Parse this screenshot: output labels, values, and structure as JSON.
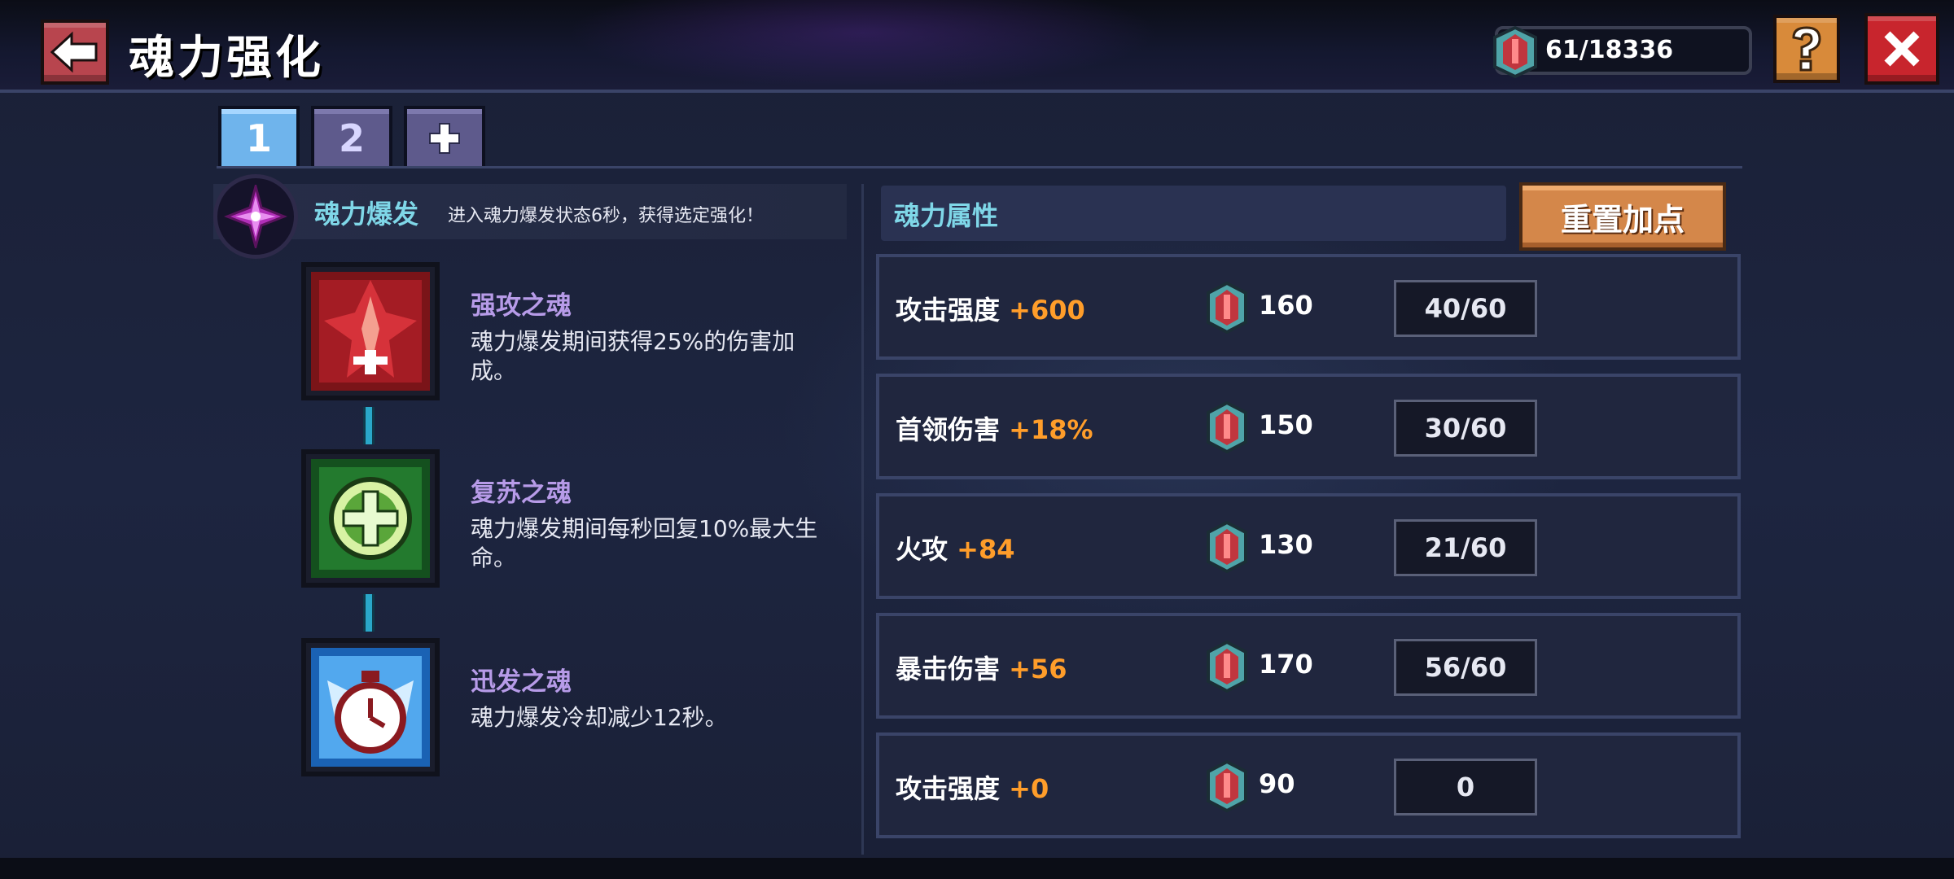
{
  "header": {
    "title": "魂力强化",
    "currency": "61/18336"
  },
  "tabs": [
    {
      "label": "1",
      "active": true
    },
    {
      "label": "2",
      "active": false
    },
    {
      "label": "+",
      "active": false
    }
  ],
  "burst": {
    "title": "魂力爆发",
    "description": "进入魂力爆发状态6秒，获得选定强化！"
  },
  "skills": [
    {
      "name": "强攻之魂",
      "description": "魂力爆发期间获得25%的伤害加成。"
    },
    {
      "name": "复苏之魂",
      "description": "魂力爆发期间每秒回复10%最大生命。"
    },
    {
      "name": "迅发之魂",
      "description": "魂力爆发冷却减少12秒。"
    }
  ],
  "attributes": {
    "title": "魂力属性",
    "reset_label": "重置加点",
    "rows": [
      {
        "label": "攻击强度",
        "bonus": "+600",
        "cost": "160",
        "level": "40/60"
      },
      {
        "label": "首领伤害",
        "bonus": "+18%",
        "cost": "150",
        "level": "30/60"
      },
      {
        "label": "火攻",
        "bonus": "+84",
        "cost": "130",
        "level": "21/60"
      },
      {
        "label": "暴击伤害",
        "bonus": "+56",
        "cost": "170",
        "level": "56/60"
      },
      {
        "label": "攻击强度",
        "bonus": "+0",
        "cost": "90",
        "level": "0"
      }
    ]
  },
  "colors": {
    "accent_cyan": "#7fd7e8",
    "skill_purple": "#b79be8",
    "bonus_orange": "#ff9d2a"
  }
}
